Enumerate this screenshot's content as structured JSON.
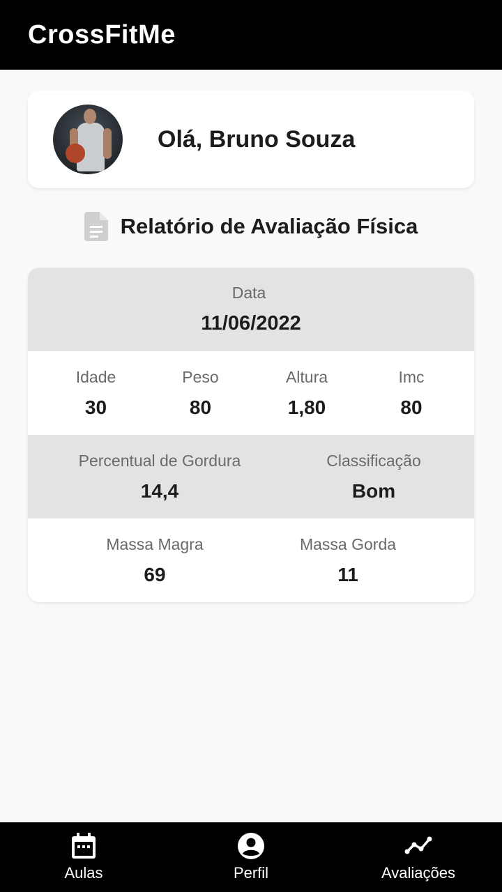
{
  "app": {
    "title": "CrossFitMe"
  },
  "greeting": {
    "text": "Olá, Bruno Souza"
  },
  "report": {
    "title": "Relatório de Avaliação Física",
    "date": {
      "label": "Data",
      "value": "11/06/2022"
    },
    "metrics": [
      {
        "label": "Idade",
        "value": "30"
      },
      {
        "label": "Peso",
        "value": "80"
      },
      {
        "label": "Altura",
        "value": "1,80"
      },
      {
        "label": "Imc",
        "value": "80"
      }
    ],
    "body_fat": {
      "label": "Percentual de Gordura",
      "value": "14,4"
    },
    "classification": {
      "label": "Classificação",
      "value": "Bom"
    },
    "lean_mass": {
      "label": "Massa Magra",
      "value": "69"
    },
    "fat_mass": {
      "label": "Massa Gorda",
      "value": "11"
    }
  },
  "nav": {
    "items": [
      {
        "label": "Aulas",
        "icon": "calendar-icon"
      },
      {
        "label": "Perfil",
        "icon": "account-circle-icon"
      },
      {
        "label": "Avaliações",
        "icon": "timeline-icon"
      }
    ]
  },
  "colors": {
    "app_bar": "#000000",
    "background": "#f9f9f9",
    "row_gray": "#e3e3e3",
    "label_gray": "#6a6a6a"
  }
}
